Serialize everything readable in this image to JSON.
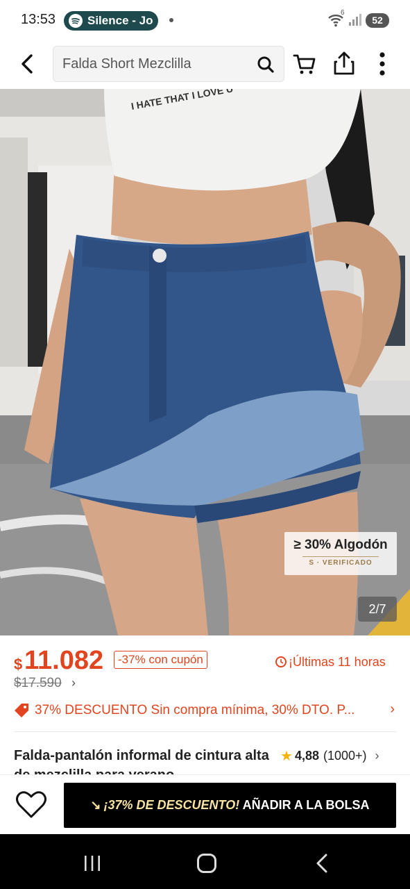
{
  "status_bar": {
    "time": "13:53",
    "media_pill": "Silence - Jo",
    "wifi_badge": "6",
    "battery": "52"
  },
  "top_bar": {
    "search_text": "Falda Short Mezclilla",
    "icons": [
      "back-arrow-icon",
      "search-icon",
      "cart-icon",
      "share-icon",
      "more-vertical-icon"
    ]
  },
  "gallery": {
    "badge_main": "≥ 30% Algodón",
    "badge_sub": "S · VERIFICADO",
    "counter": "2/7"
  },
  "price": {
    "currency": "$",
    "value": "11.082",
    "coupon": "-37% con cupón",
    "timer": "¡Últimas 11 horas",
    "old_price": "$17.590",
    "old_chevron": "›"
  },
  "promo": {
    "text": "37% DESCUENTO Sin compra mínima,  30% DTO. P...",
    "chevron": "›"
  },
  "product": {
    "title": "Falda-pantalón informal de cintura alta de mezclilla para verano",
    "rating": "4,88",
    "reviews": "(1000+)",
    "chevron": "›"
  },
  "action_bar": {
    "bag_arrow": "↘",
    "bag_promo": "¡37% DE DESCUENTO!",
    "bag_label": " AÑADIR A LA BOLSA"
  },
  "colors": {
    "accent": "#e0451f",
    "pill": "#1e4a4d",
    "button": "#000000",
    "star": "#f5b301"
  }
}
